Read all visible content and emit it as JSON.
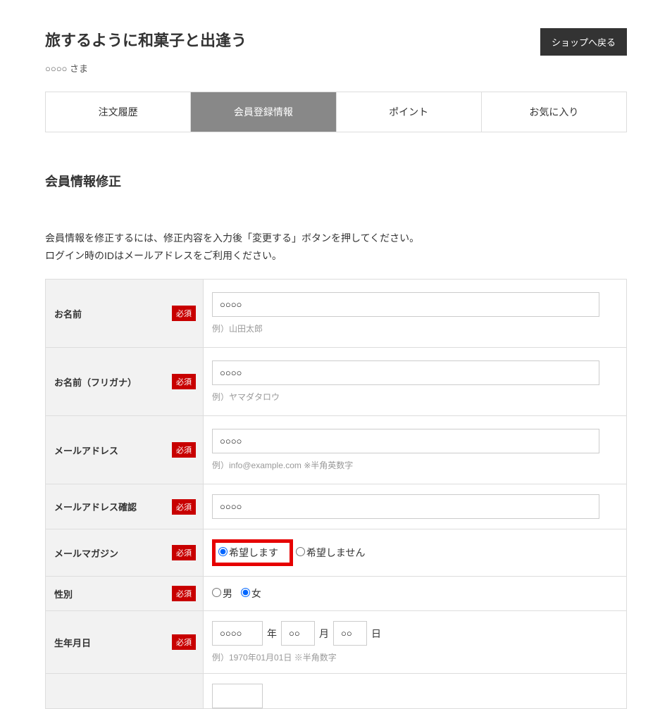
{
  "header": {
    "title": "旅するように和菓子と出逢う",
    "back_button": "ショップへ戻る",
    "username": "○○○○ さま"
  },
  "tabs": {
    "order_history": "注文履歴",
    "member_info": "会員登録情報",
    "points": "ポイント",
    "favorites": "お気に入り"
  },
  "section": {
    "title": "会員情報修正",
    "instruction1": "会員情報を修正するには、修正内容を入力後「変更する」ボタンを押してください。",
    "instruction2": "ログイン時のIDはメールアドレスをご利用ください。"
  },
  "labels": {
    "required": "必須",
    "name": "お名前",
    "name_kana": "お名前（フリガナ）",
    "email": "メールアドレス",
    "email_confirm": "メールアドレス確認",
    "mailmag": "メールマガジン",
    "gender": "性別",
    "birthdate": "生年月日"
  },
  "values": {
    "name": "○○○○",
    "name_kana": "○○○○",
    "email": "○○○○",
    "email_confirm": "○○○○",
    "year": "○○○○",
    "month": "○○",
    "day": "○○"
  },
  "hints": {
    "name": "例）山田太郎",
    "name_kana": "例）ヤマダタロウ",
    "email": "例）info@example.com ※半角英数字",
    "birthdate": "例）1970年01月01日 ※半角数字"
  },
  "options": {
    "mailmag_yes": "希望します",
    "mailmag_no": "希望しません",
    "gender_male": "男",
    "gender_female": "女",
    "year_unit": "年",
    "month_unit": "月",
    "day_unit": "日"
  }
}
